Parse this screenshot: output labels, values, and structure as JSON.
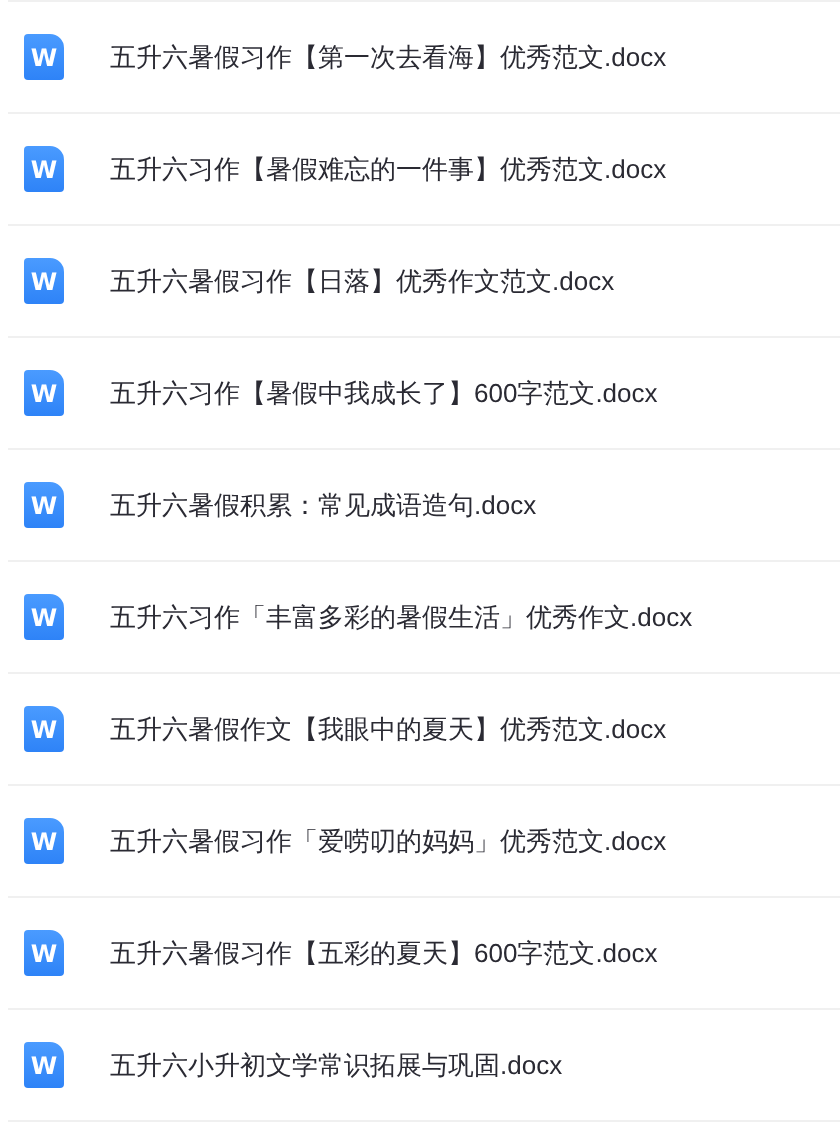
{
  "files": [
    {
      "icon": "W",
      "name": "五升六暑假习作【第一次去看海】优秀范文.docx"
    },
    {
      "icon": "W",
      "name": "五升六习作【暑假难忘的一件事】优秀范文.docx"
    },
    {
      "icon": "W",
      "name": "五升六暑假习作【日落】优秀作文范文.docx"
    },
    {
      "icon": "W",
      "name": "五升六习作【暑假中我成长了】600字范文.docx"
    },
    {
      "icon": "W",
      "name": "五升六暑假积累：常见成语造句.docx"
    },
    {
      "icon": "W",
      "name": "五升六习作「丰富多彩的暑假生活」优秀作文.docx"
    },
    {
      "icon": "W",
      "name": "五升六暑假作文【我眼中的夏天】优秀范文.docx"
    },
    {
      "icon": "W",
      "name": "五升六暑假习作「爱唠叨的妈妈」优秀范文.docx"
    },
    {
      "icon": "W",
      "name": "五升六暑假习作【五彩的夏天】600字范文.docx"
    },
    {
      "icon": "W",
      "name": "五升六小升初文学常识拓展与巩固.docx"
    }
  ]
}
